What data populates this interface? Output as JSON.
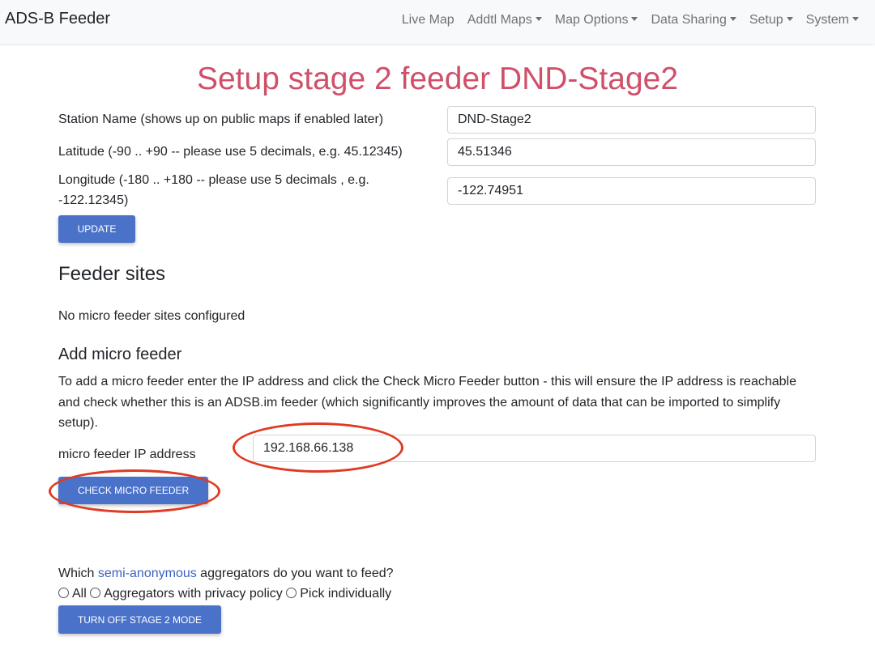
{
  "navbar": {
    "brand": "ADS-B Feeder",
    "items": [
      {
        "label": "Live Map",
        "dropdown": false
      },
      {
        "label": "Addtl Maps",
        "dropdown": true
      },
      {
        "label": "Map Options",
        "dropdown": true
      },
      {
        "label": "Data Sharing",
        "dropdown": true
      },
      {
        "label": "Setup",
        "dropdown": true
      },
      {
        "label": "System",
        "dropdown": true
      }
    ]
  },
  "page": {
    "title": "Setup stage 2 feeder DND-Stage2"
  },
  "station": {
    "name_label": "Station Name (shows up on public maps if enabled later)",
    "name_value": "DND-Stage2",
    "lat_label": "Latitude (-90 .. +90 -- please use 5 decimals, e.g. 45.12345)",
    "lat_value": "45.51346",
    "lon_label_line1": "Longitude (-180 .. +180 -- please use 5 decimals , e.g.",
    "lon_label_line2": "-122.12345)",
    "lon_value": "-122.74951",
    "update_button": "UPDATE"
  },
  "feeder_sites": {
    "heading": "Feeder sites",
    "empty_text": "No micro feeder sites configured"
  },
  "add_micro": {
    "heading": "Add micro feeder",
    "description": "To add a micro feeder enter the IP address and click the Check Micro Feeder button - this will ensure the IP address is reachable and check whether this is an ADSB.im feeder (which significantly improves the amount of data that can be imported to simplify setup).",
    "ip_label": "micro feeder IP address",
    "ip_value": "192.168.66.138",
    "check_button": "CHECK MICRO FEEDER"
  },
  "aggregators": {
    "question_prefix": "Which ",
    "question_link": "semi-anonymous",
    "question_suffix": " aggregators do you want to feed?",
    "options": [
      "All",
      "Aggregators with privacy policy",
      "Pick individually"
    ],
    "stage2_button": "TURN OFF STAGE 2 MODE"
  },
  "colors": {
    "title": "#d0506a",
    "button": "#4a72c9",
    "link": "#3b62c1",
    "annotation": "#e03a22"
  }
}
